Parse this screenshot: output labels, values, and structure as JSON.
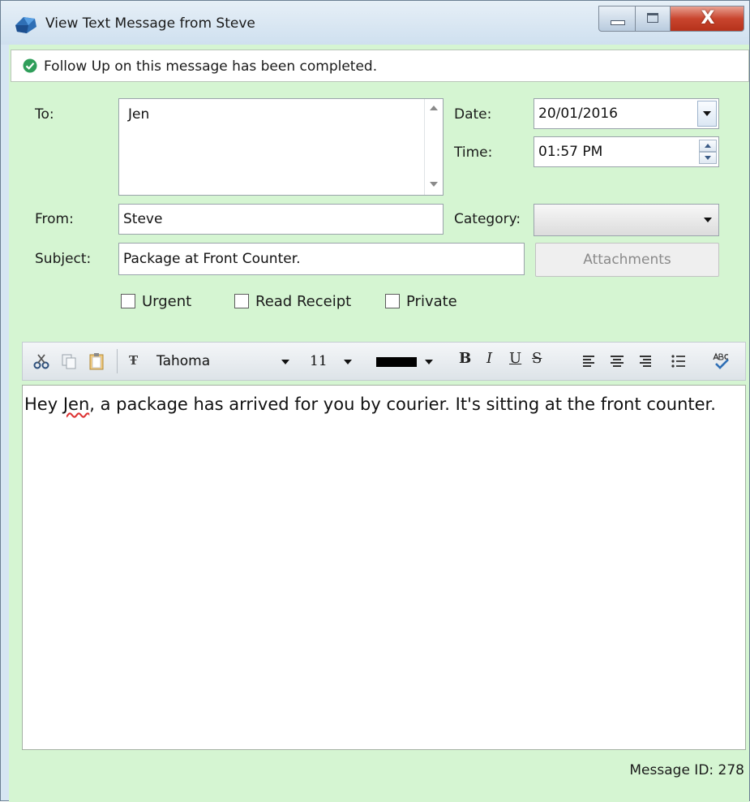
{
  "window": {
    "title": "View Text Message from Steve",
    "close_glyph": "X"
  },
  "banner": {
    "text": "Follow Up on this message has been completed.",
    "icon": "check-circle-icon"
  },
  "form": {
    "to_label": "To:",
    "to_value": "Jen",
    "date_label": "Date:",
    "date_value": "20/01/2016",
    "time_label": "Time:",
    "time_value": "01:57 PM",
    "from_label": "From:",
    "from_value": "Steve",
    "category_label": "Category:",
    "category_value": "",
    "subject_label": "Subject:",
    "subject_value": "Package at Front Counter.",
    "attachments_label": "Attachments"
  },
  "options": [
    {
      "label": "Urgent",
      "checked": false
    },
    {
      "label": "Read Receipt",
      "checked": false
    },
    {
      "label": "Private",
      "checked": false
    }
  ],
  "toolbar": {
    "font": "Tahoma",
    "font_glyph": "Ŧ",
    "size": "11",
    "text_color": "#000000",
    "bold": "B",
    "italic": "I",
    "underline": "U",
    "strike": "S"
  },
  "message": {
    "body_before": "Hey ",
    "body_word": "Jen",
    "body_after": ", a package has arrived for you by courier.  It's sitting at the front counter.",
    "id_text": "Message ID: 278"
  },
  "colors": {
    "panel": "#d5f5d2",
    "accent": "#3b73b9",
    "check": "#2f9e5a",
    "close": "#c9452e"
  }
}
